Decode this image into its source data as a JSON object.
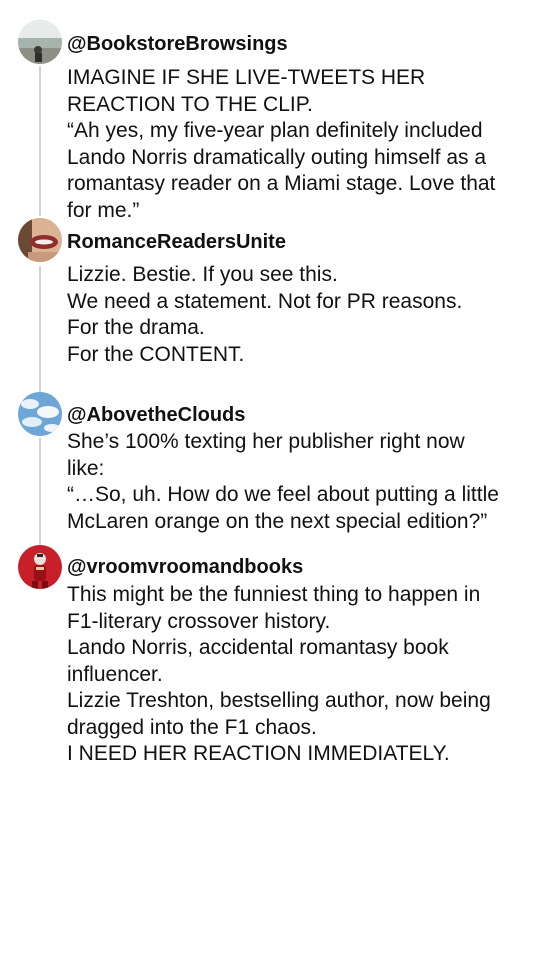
{
  "thread": {
    "posts": [
      {
        "handle": "@BookstoreBrowsings",
        "avatar_icon": "bookstore-photo-avatar",
        "lines": [
          "IMAGINE IF SHE LIVE-TWEETS HER",
          "REACTION TO THE CLIP.",
          "“Ah yes, my five-year plan definitely included",
          "Lando Norris dramatically outing himself as a",
          "romantasy reader on a Miami stage. Love that",
          "for me.”"
        ]
      },
      {
        "handle": "RomanceReadersUnite",
        "avatar_icon": "lips-photo-avatar",
        "lines": [
          "Lizzie. Bestie. If you see this.",
          "We need a statement. Not for PR reasons.",
          "For the drama.",
          "For the CONTENT."
        ]
      },
      {
        "handle": "@AbovetheClouds",
        "avatar_icon": "clouds-photo-avatar",
        "lines": [
          "She’s 100% texting her publisher right now",
          "like:",
          "“…So, uh. How do we feel about putting a little",
          "McLaren orange on the next special edition?”"
        ]
      },
      {
        "handle": "@vroomvroomandbooks",
        "avatar_icon": "racer-photo-avatar",
        "lines": [
          "This might be the funniest thing to happen in",
          "F1-literary crossover history.",
          "Lando Norris, accidental romantasy book",
          "influencer.",
          "Lizzie Treshton, bestselling author, now being",
          "dragged into the F1 chaos.",
          "I NEED HER REACTION IMMEDIATELY."
        ]
      }
    ]
  }
}
